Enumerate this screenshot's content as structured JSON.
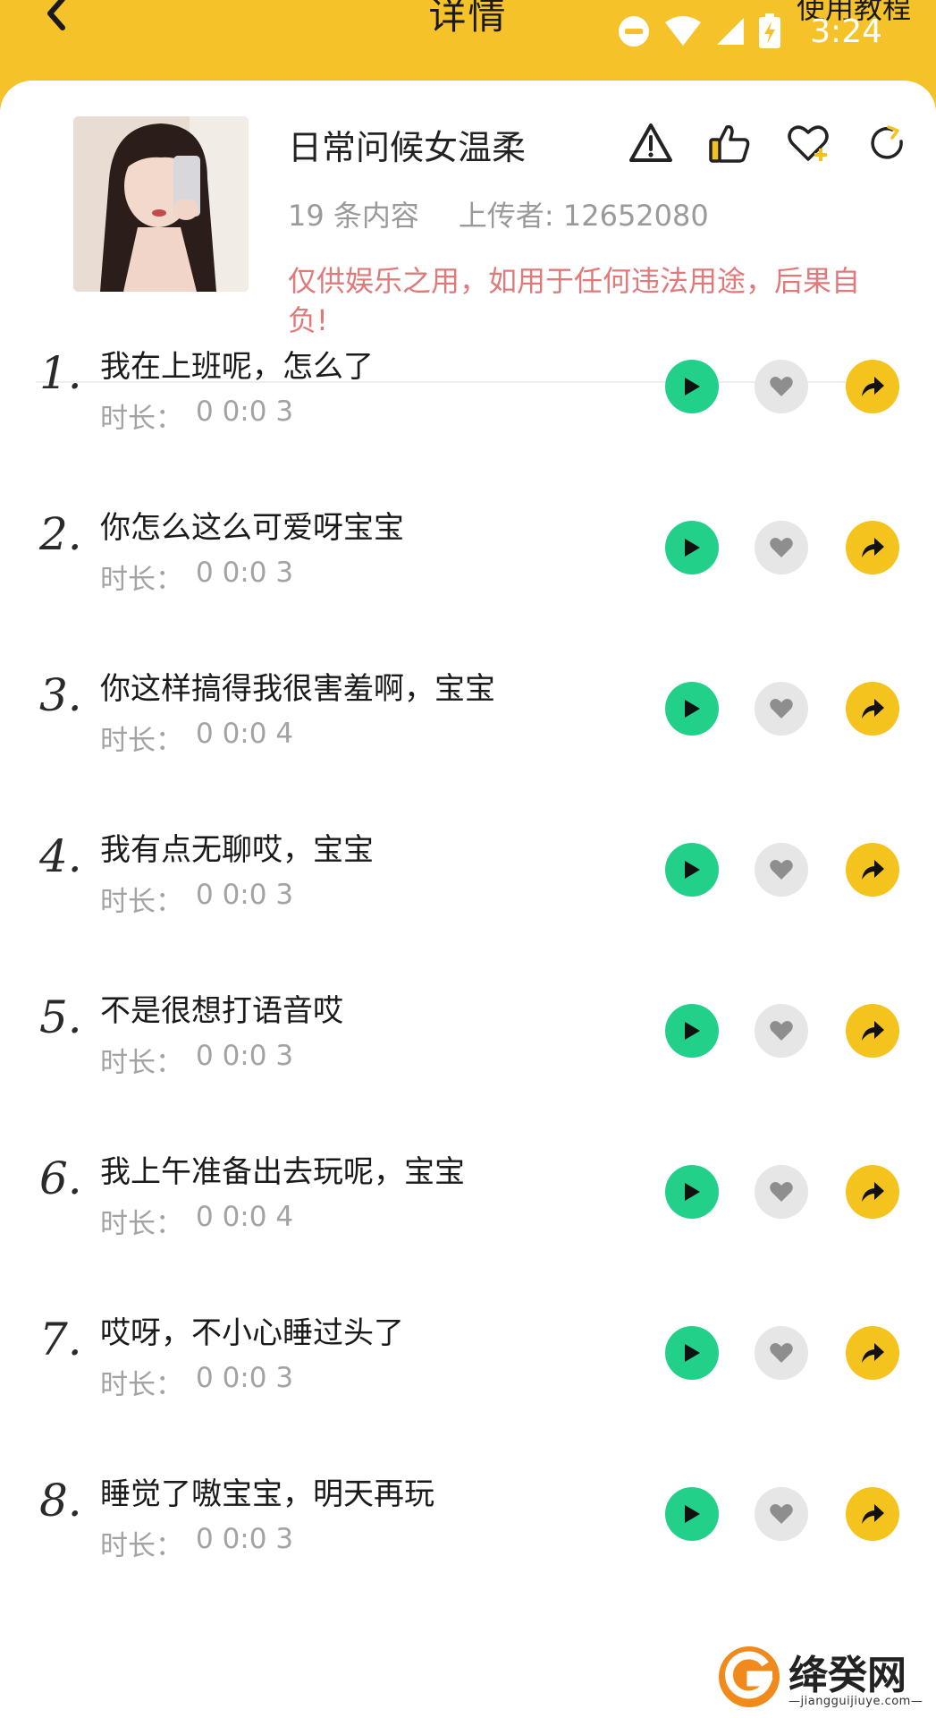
{
  "header": {
    "title": "详情",
    "tutorial_label": "使用教程",
    "clock": "3:24",
    "background_color": "#f5c22a",
    "icons": [
      "back-arrow-icon",
      "do-not-disturb-icon",
      "wifi-icon",
      "cell-signal-icon",
      "battery-charging-icon"
    ]
  },
  "pack": {
    "title": "日常问候女温柔",
    "count_text": "19 条内容",
    "uploader_text": "上传者: 12652080",
    "disclaimer": "仅供娱乐之用，如用于任何违法用途，后果自负!",
    "actions": [
      "warning-icon",
      "thumbs-up-icon",
      "favorite-add-icon",
      "refresh-icon"
    ]
  },
  "list": {
    "duration_label": "时长：",
    "play_color": "#22d08a",
    "share_color": "#f4c31e",
    "items": [
      {
        "num": "1.",
        "text": "我在上班呢，怎么了",
        "duration": "0 0:0 3"
      },
      {
        "num": "2.",
        "text": "你怎么这么可爱呀宝宝",
        "duration": "0 0:0 3"
      },
      {
        "num": "3.",
        "text": "你这样搞得我很害羞啊，宝宝",
        "duration": "0 0:0 4"
      },
      {
        "num": "4.",
        "text": "我有点无聊哎，宝宝",
        "duration": "0 0:0 3"
      },
      {
        "num": "5.",
        "text": "不是很想打语音哎",
        "duration": "0 0:0 3"
      },
      {
        "num": "6.",
        "text": "我上午准备出去玩呢，宝宝",
        "duration": "0 0:0 4"
      },
      {
        "num": "7.",
        "text": "哎呀，不小心睡过头了",
        "duration": "0 0:0 3"
      },
      {
        "num": "8.",
        "text": "睡觉了嗷宝宝，明天再玩",
        "duration": "0 0:0 3"
      }
    ]
  },
  "watermark": {
    "name": "绛癸网",
    "url": "—jiangguijiuye.com—"
  }
}
